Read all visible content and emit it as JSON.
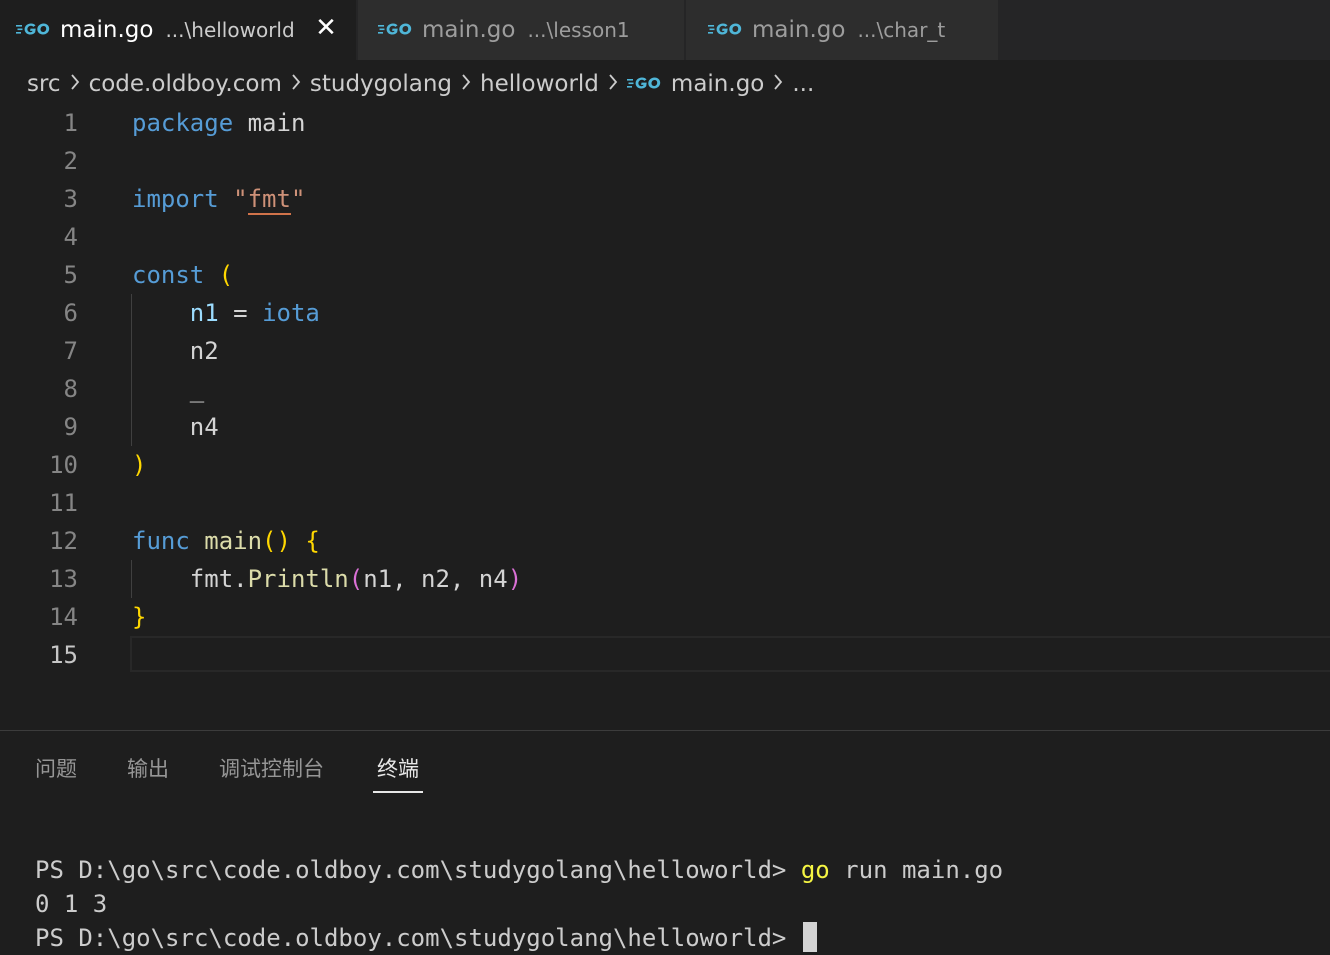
{
  "tabs": [
    {
      "file": "main.go",
      "desc": "...\\helloworld",
      "active": true,
      "close": "✕"
    },
    {
      "file": "main.go",
      "desc": "...\\lesson1",
      "active": false
    },
    {
      "file": "main.go",
      "desc": "...\\char_t",
      "active": false
    }
  ],
  "breadcrumb": [
    "src",
    "code.oldboy.com",
    "studygolang",
    "helloworld",
    "main.go",
    "..."
  ],
  "editor": {
    "line_numbers": [
      "1",
      "2",
      "3",
      "4",
      "5",
      "6",
      "7",
      "8",
      "9",
      "10",
      "11",
      "12",
      "13",
      "14",
      "15"
    ],
    "current_line": "15",
    "tokens": {
      "package_kw": "package",
      "package_name": "main",
      "import_kw": "import",
      "import_q1": "\"",
      "import_path": "fmt",
      "import_q2": "\"",
      "const_kw": "const",
      "open_paren": "(",
      "n1": "n1",
      "assign": "=",
      "iota": "iota",
      "n2": "n2",
      "blank": "_",
      "n4": "n4",
      "close_paren": ")",
      "func_kw": "func",
      "func_name": "main",
      "func_parens": "()",
      "open_brace": "{",
      "fmt_pkg": "fmt.",
      "println": "Println",
      "call_open": "(",
      "call_args": "n1, n2, n4",
      "call_close": ")",
      "close_brace": "}"
    }
  },
  "panel": {
    "tabs": [
      "问题",
      "输出",
      "调试控制台",
      "终端"
    ],
    "active_tab": "终端",
    "terminal": {
      "prompt1": "PS D:\\go\\src\\code.oldboy.com\\studygolang\\helloworld> ",
      "cmd_go": "go",
      "cmd_rest": " run main.go",
      "output": "0 1 3",
      "prompt2": "PS D:\\go\\src\\code.oldboy.com\\studygolang\\helloworld> "
    }
  },
  "colors": {
    "keyword": "#569cd6",
    "function": "#dcdcaa",
    "string": "#ce9178",
    "bracket_level1": "#ffd700",
    "bracket_level2": "#da70d6",
    "go_logo": "#4fb6d8"
  },
  "icons": {
    "go_file": "go-logo-icon",
    "close": "close-icon",
    "chevron": "chevron-right-icon"
  }
}
